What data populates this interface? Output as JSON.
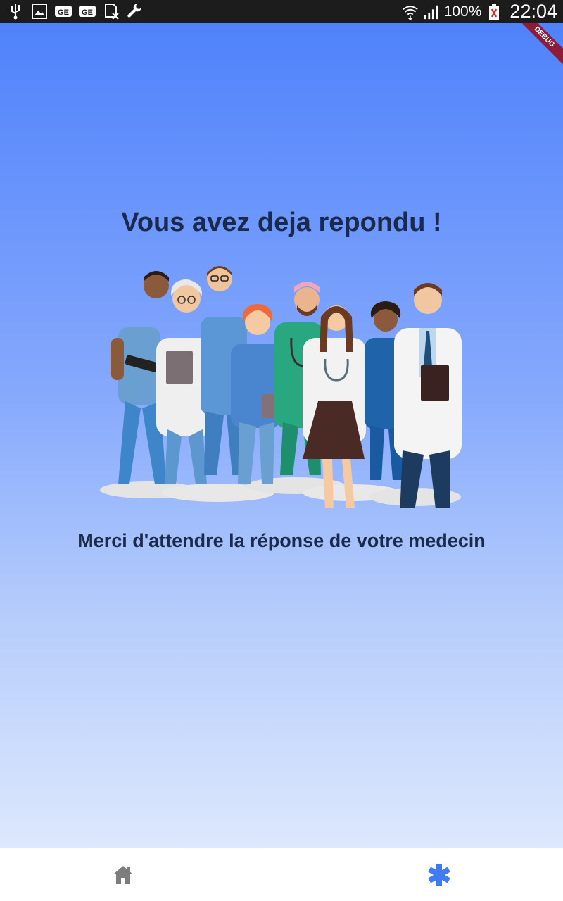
{
  "status_bar": {
    "battery_percent": "100%",
    "time": "22:04",
    "left_icons": [
      "usb-icon",
      "image-icon",
      "ge-badge-icon",
      "ge-badge-icon",
      "sim-icon",
      "wrench-icon"
    ],
    "right_icons": [
      "wifi-icon",
      "signal-icon",
      "battery-icon"
    ]
  },
  "debug_banner": "DEBUG",
  "main": {
    "title": "Vous avez deja repondu !",
    "illustration": "medical-team-illustration",
    "message": "Merci d'attendre la réponse de votre medecin"
  },
  "bottom_nav": {
    "items": [
      {
        "icon": "home-icon",
        "color": "#7d7d7d"
      },
      {
        "icon": "asterisk-icon",
        "color": "#3f7bf5"
      }
    ]
  },
  "colors": {
    "gradient_top": "#4f82fb",
    "gradient_bottom": "#dde8fd",
    "text": "#1b2a4a",
    "accent": "#3f7bf5"
  }
}
